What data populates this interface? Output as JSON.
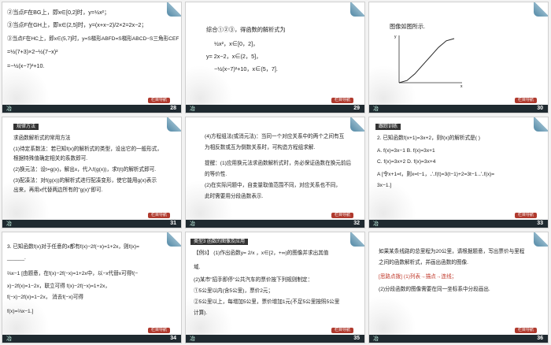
{
  "slides": [
    {
      "number": "28",
      "lines": [
        "②当点F在BG上，即x∈[0,2]时，y=½x²；",
        "③当点F在GH上，即x∈(2,5]时，y=(x+x−2)/2×2=2x−2；",
        "③当点F在HC上，即x∈(5,7]时，y=S梯形ABFD=S梯形ABCD−S三角形CEF",
        "=½(7+3)×2−½(7−x)²",
        "=−½(x−7)²+10."
      ]
    },
    {
      "number": "29",
      "lines": [
        "综合①②③，得函数的解析式为",
        "½x²，x∈[0，2]，",
        "y=  2x−2，x∈(2，5]，",
        "−½(x−7)²+10，x∈(5，7]."
      ]
    },
    {
      "number": "30",
      "lines": [
        "图像如图所示."
      ]
    },
    {
      "number": "31",
      "header": "规律方法",
      "lines": [
        "求函数解析式的常用方法",
        "(1)待定系数法：若已知f(x)的解析式的类型，设出它的一般形式，",
        "根据特殊值确定相关的系数即可.",
        "(2)换元法：设t=g(x)，解出x，代入f(g(x))，求f(t)的解析式即可.",
        "(3)配凑法：对f(g(x))的解析式进行配凑变形，使它能用g(x)表示",
        "出来，再用x代替两边所有的\"g(x)\"即可."
      ]
    },
    {
      "number": "32",
      "lines": [
        "(4)方程组法(或消元法)：当同一个对应关系中的两个之间有互",
        "为相反数或互为倒数关系时，可构造方程组求解.",
        "提醒：(1)应用换元法求函数解析式时，务必保证函数在换元前后",
        "的等价性.",
        "(2)在实际问题中，自变量取值范围不同，对应关系也不同，",
        "此时需要用分段函数表示."
      ]
    },
    {
      "number": "33",
      "header": "跟踪训练",
      "lines": [
        "2. 已知函数f(x+1)=3x+2，则f(x)的解析式是(    )",
        "A. f(x)=3x−1          B. f(x)=3x+1",
        "C. f(x)=3x+2          D. f(x)=3x+4",
        "A  [令x+1=t，则x=t−1，∴f(t)=3(t−1)+2=3t−1.∴f(x)=",
        "3x−1.]"
      ]
    },
    {
      "number": "34",
      "lines": [
        "3. 已知函数f(x)对于任意的x都有f(x)−2f(−x)=1+2x，则f(x)=",
        "______.",
        "⅔x−1  [由题意，在f(x)−2f(−x)=1+2x中，以−x代替x可得f(−",
        "x)−2f(x)=1−2x，联立可得 f(x)−2f(−x)=1+2x，",
        "f(−x)−2f(x)=1−2x，  消去f(−x)可得",
        "f(x)=⅔x−1.]"
      ]
    },
    {
      "number": "35",
      "header": "类型3 函数的图像及应用",
      "lines": [
        "【例3】 (1)作出函数y= 2/x ，x∈[2，+∞)的图像并求出其值",
        "域.",
        "(2)某市\"招手即停\"公共汽车的票价按下列规则制定：",
        "①5公里以内(含5公里)，票价2元；",
        "②5公里以上，每增加5公里，票价增加1元(不足5公里按照5公里",
        "计算)."
      ]
    },
    {
      "number": "36",
      "lines": [
        "如果某条线路的总里程为20公里，请根据题意，写出票价与里程",
        "之间的函数解析式，并画出函数的图像.",
        "[思路点拨] (1)列表→描点→连线；",
        "(2)分段函数的图像需要在同一坐标系中分段画出."
      ]
    }
  ],
  "footer": {
    "left": "冶",
    "pill": "栏目导航"
  },
  "graph": {
    "y_label": "y",
    "x_label": "x",
    "points": [
      [
        0,
        0
      ],
      [
        1,
        0.5
      ],
      [
        2,
        2
      ],
      [
        3,
        4
      ],
      [
        4,
        6
      ],
      [
        5,
        8
      ],
      [
        6,
        9.5
      ],
      [
        7,
        10
      ]
    ]
  }
}
